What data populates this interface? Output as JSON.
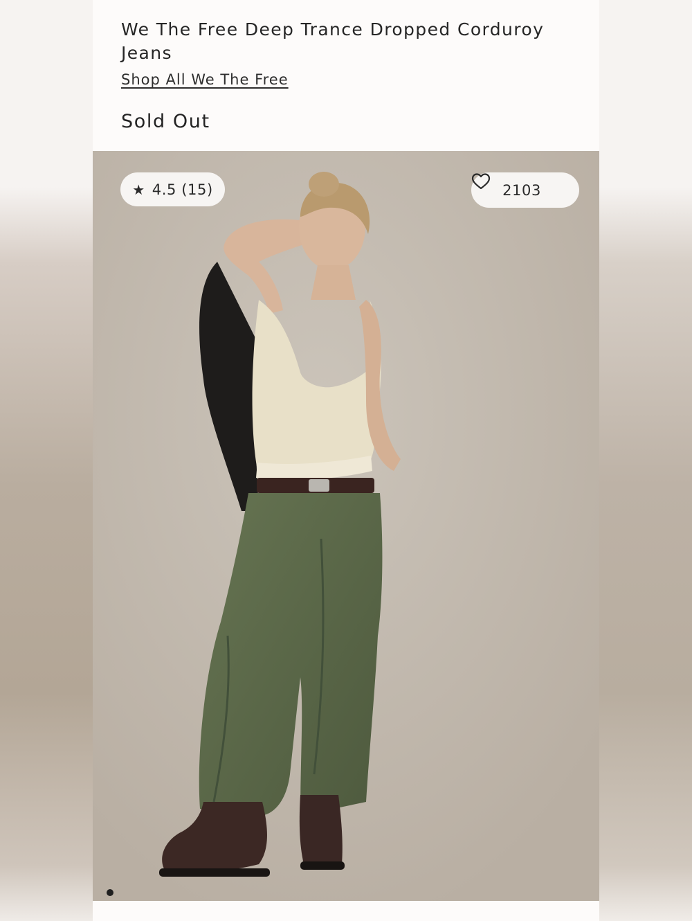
{
  "product": {
    "title": "We The Free Deep Trance Dropped Corduroy Jeans",
    "shop_link": "Shop All We The Free",
    "status": "Sold Out"
  },
  "gallery": {
    "rating_text": "4.5 (15)",
    "rating_icon": "star-icon",
    "favorites_count": "2103",
    "favorite_icon": "heart-icon",
    "carousel_index": 1
  },
  "colors": {
    "background": "#fcfbfa",
    "text": "#262626",
    "pill": "#f7f5f3",
    "photo_backdrop": "#c2bab0"
  }
}
